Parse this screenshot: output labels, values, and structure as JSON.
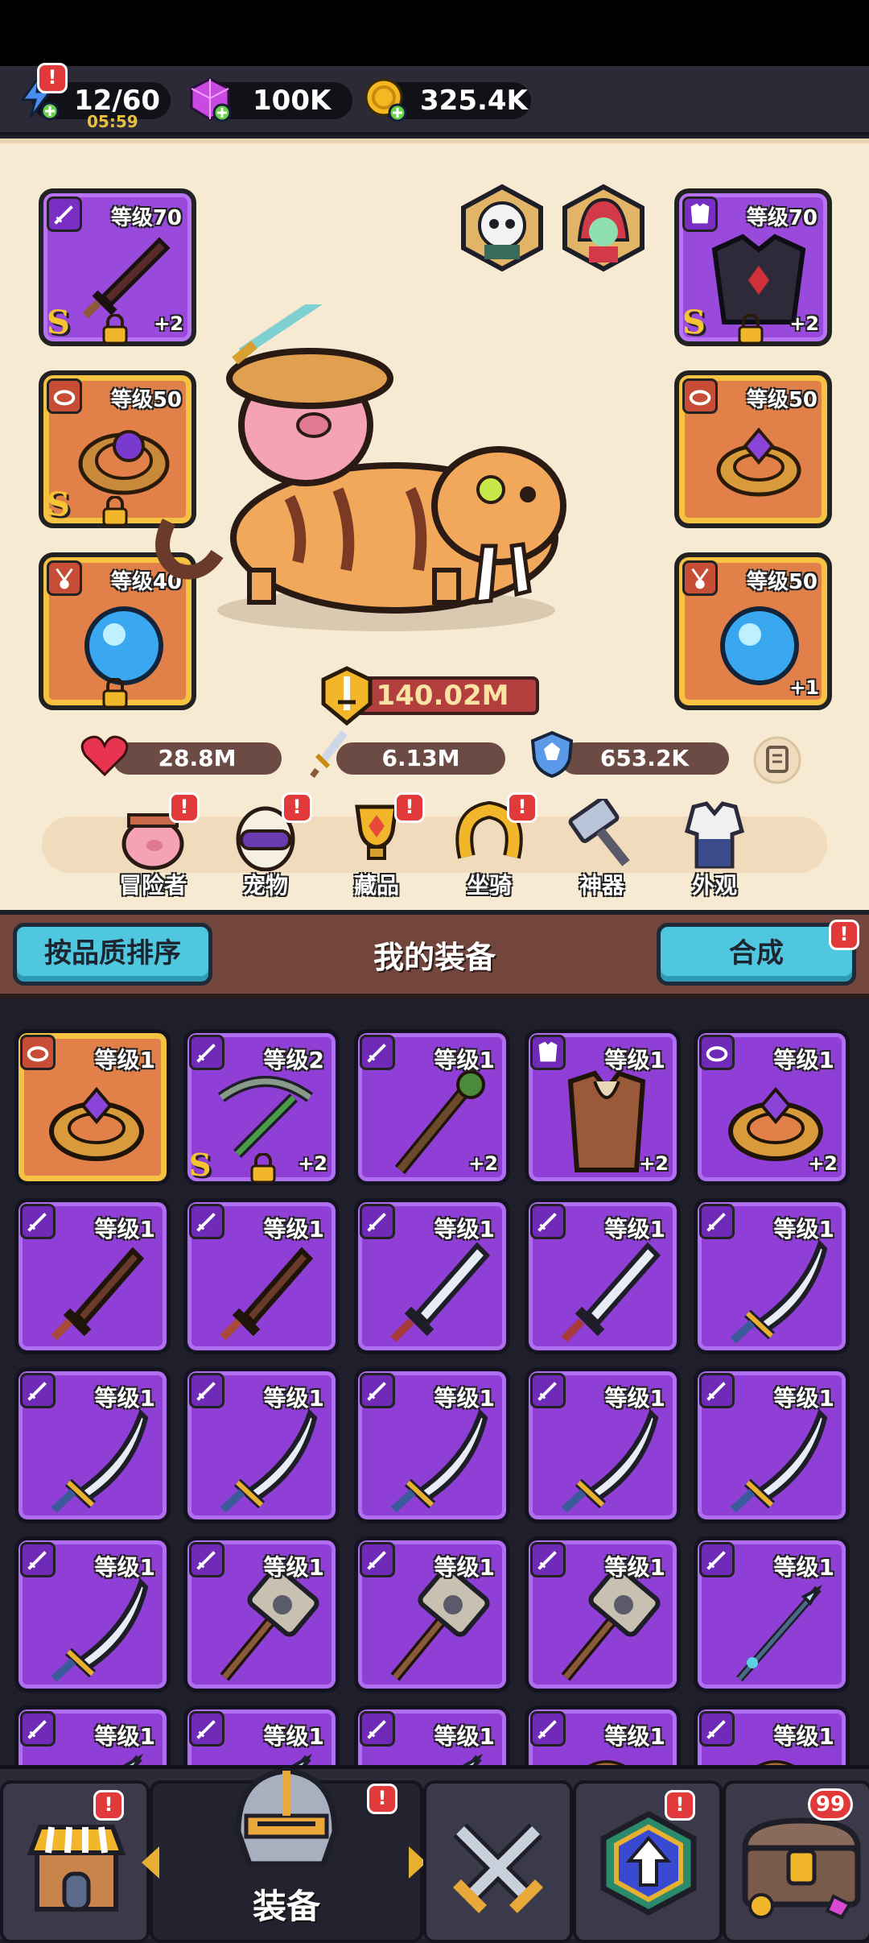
{
  "resources": {
    "energy": "12/60",
    "energy_timer": "05:59",
    "gems": "100K",
    "gold": "325.4K",
    "badge_mark": "!"
  },
  "equipped_left": [
    {
      "level": "等级70",
      "grade": "S",
      "plus": "+2",
      "type": "sword-icon",
      "quality": "purple",
      "locked": true
    },
    {
      "level": "等级50",
      "grade": "S",
      "plus": "",
      "type": "ring-icon",
      "quality": "orange",
      "locked": true
    },
    {
      "level": "等级40",
      "grade": "",
      "plus": "",
      "type": "amulet-icon",
      "quality": "orange",
      "locked": true
    }
  ],
  "equipped_right": [
    {
      "level": "等级70",
      "grade": "S",
      "plus": "+2",
      "type": "armor-icon",
      "quality": "purple",
      "locked": true
    },
    {
      "level": "等级50",
      "grade": "",
      "plus": "",
      "type": "ring-icon",
      "quality": "orange",
      "locked": false
    },
    {
      "level": "等级50",
      "grade": "",
      "plus": "+1",
      "type": "amulet-icon",
      "quality": "orange",
      "locked": false
    }
  ],
  "power": "140.02M",
  "stats": {
    "hp": "28.8M",
    "attack": "6.13M",
    "defense": "653.2K"
  },
  "nav": [
    {
      "label": "冒险者",
      "icon": "adventurer-icon",
      "badge": true
    },
    {
      "label": "宠物",
      "icon": "pet-egg-icon",
      "badge": true
    },
    {
      "label": "藏品",
      "icon": "trophy-icon",
      "badge": true
    },
    {
      "label": "坐骑",
      "icon": "horseshoe-icon",
      "badge": true
    },
    {
      "label": "神器",
      "icon": "hammer-icon",
      "badge": false
    },
    {
      "label": "外观",
      "icon": "outfit-icon",
      "badge": false
    }
  ],
  "equipment_bar": {
    "sort_button": "按品质排序",
    "title": "我的装备",
    "merge_button": "合成"
  },
  "inventory": [
    {
      "level": "等级1",
      "plus": "",
      "grade": "",
      "quality": "orange",
      "type": "ring-icon",
      "art": "ring"
    },
    {
      "level": "等级2",
      "plus": "+2",
      "grade": "S",
      "quality": "purple",
      "type": "sword-icon",
      "art": "crossbow",
      "locked": true
    },
    {
      "level": "等级1",
      "plus": "+2",
      "grade": "",
      "quality": "purple",
      "type": "sword-icon",
      "art": "staff"
    },
    {
      "level": "等级1",
      "plus": "+2",
      "grade": "",
      "quality": "purple",
      "type": "armor-icon",
      "art": "vest"
    },
    {
      "level": "等级1",
      "plus": "+2",
      "grade": "",
      "quality": "purple",
      "type": "ring-icon",
      "art": "ring"
    },
    {
      "level": "等级1",
      "plus": "",
      "grade": "",
      "quality": "purple",
      "type": "sword-icon",
      "art": "woodsword"
    },
    {
      "level": "等级1",
      "plus": "",
      "grade": "",
      "quality": "purple",
      "type": "sword-icon",
      "art": "woodsword"
    },
    {
      "level": "等级1",
      "plus": "",
      "grade": "",
      "quality": "purple",
      "type": "sword-icon",
      "art": "broadsword"
    },
    {
      "level": "等级1",
      "plus": "",
      "grade": "",
      "quality": "purple",
      "type": "sword-icon",
      "art": "broadsword"
    },
    {
      "level": "等级1",
      "plus": "",
      "grade": "",
      "quality": "purple",
      "type": "sword-icon",
      "art": "scimitar"
    },
    {
      "level": "等级1",
      "plus": "",
      "grade": "",
      "quality": "purple",
      "type": "sword-icon",
      "art": "scimitar"
    },
    {
      "level": "等级1",
      "plus": "",
      "grade": "",
      "quality": "purple",
      "type": "sword-icon",
      "art": "scimitar"
    },
    {
      "level": "等级1",
      "plus": "",
      "grade": "",
      "quality": "purple",
      "type": "sword-icon",
      "art": "scimitar"
    },
    {
      "level": "等级1",
      "plus": "",
      "grade": "",
      "quality": "purple",
      "type": "sword-icon",
      "art": "scimitar"
    },
    {
      "level": "等级1",
      "plus": "",
      "grade": "",
      "quality": "purple",
      "type": "sword-icon",
      "art": "scimitar"
    },
    {
      "level": "等级1",
      "plus": "",
      "grade": "",
      "quality": "purple",
      "type": "sword-icon",
      "art": "scimitar"
    },
    {
      "level": "等级1",
      "plus": "",
      "grade": "",
      "quality": "purple",
      "type": "sword-icon",
      "art": "hammer"
    },
    {
      "level": "等级1",
      "plus": "",
      "grade": "",
      "quality": "purple",
      "type": "sword-icon",
      "art": "hammer"
    },
    {
      "level": "等级1",
      "plus": "",
      "grade": "",
      "quality": "purple",
      "type": "sword-icon",
      "art": "hammer"
    },
    {
      "level": "等级1",
      "plus": "",
      "grade": "",
      "quality": "purple",
      "type": "sword-icon",
      "art": "spear"
    },
    {
      "level": "等级1",
      "plus": "",
      "grade": "",
      "quality": "purple",
      "type": "sword-icon",
      "art": "spear"
    },
    {
      "level": "等级1",
      "plus": "",
      "grade": "",
      "quality": "purple",
      "type": "sword-icon",
      "art": "spear"
    },
    {
      "level": "等级1",
      "plus": "",
      "grade": "",
      "quality": "purple",
      "type": "sword-icon",
      "art": "spear"
    },
    {
      "level": "等级1",
      "plus": "",
      "grade": "",
      "quality": "purple",
      "type": "sword-icon",
      "art": "bow"
    },
    {
      "level": "等级1",
      "plus": "",
      "grade": "",
      "quality": "purple",
      "type": "sword-icon",
      "art": "bow"
    }
  ],
  "bottom_tabs": {
    "shop": "shop-icon",
    "equipment_label": "装备",
    "battle": "crossed-swords-icon",
    "upgrade": "upgrade-arrow-icon",
    "chest": "treasure-chest-icon",
    "chest_count": "99"
  },
  "colors": {
    "purple_quality": "#9a49dd",
    "orange_quality": "#e2804a",
    "accent_button": "#4fc8df",
    "badge": "#e23a3a"
  }
}
